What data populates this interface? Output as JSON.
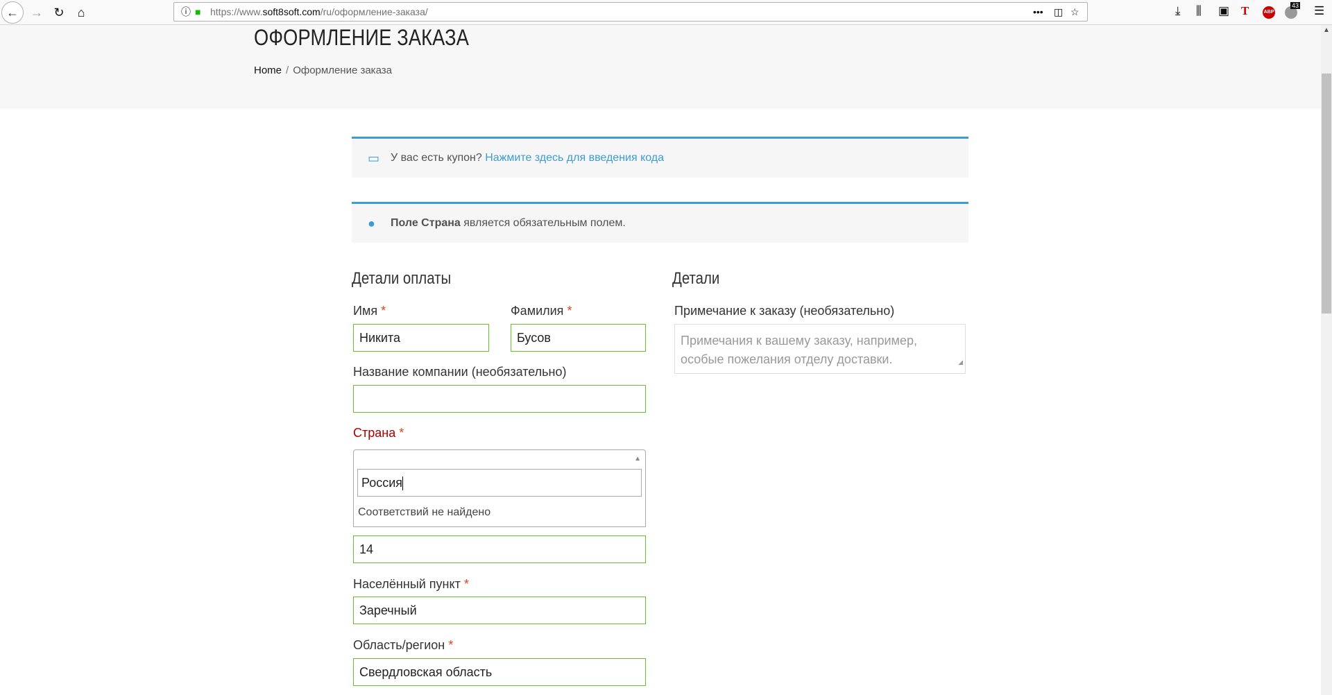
{
  "browser": {
    "url_prefix": "https://www.",
    "url_host": "soft8soft.com",
    "url_path": "/ru/оформление-заказа/",
    "badge_count": "43",
    "adblock_label": "ABP"
  },
  "page": {
    "title": "ОФОРМЛЕНИЕ ЗАКАЗА",
    "breadcrumb_home": "Home",
    "breadcrumb_sep": "/",
    "breadcrumb_current": "Оформление заказа"
  },
  "coupon_notice": {
    "text": "У вас есть купон?",
    "link": "Нажмите здесь для введения кода"
  },
  "error_notice": {
    "bold": "Поле Страна",
    "text": "является обязательным полем."
  },
  "billing": {
    "title": "Детали оплаты",
    "first_name_label": "Имя",
    "first_name_value": "Никита",
    "last_name_label": "Фамилия",
    "last_name_value": "Бусов",
    "company_label": "Название компании (необязательно)",
    "company_value": "",
    "country_label": "Страна",
    "country_search_value": "Россия",
    "country_no_results": "Соответствий не найдено",
    "address_value": "14",
    "city_label": "Населённый пункт",
    "city_value": "Заречный",
    "region_label": "Область/регион",
    "region_value": "Свердловская область",
    "required_mark": "*"
  },
  "details": {
    "title": "Детали",
    "notes_label": "Примечание к заказу (необязательно)",
    "notes_placeholder": "Примечания к вашему заказу, например, особые пожелания отделу доставки."
  },
  "colors": {
    "accent": "#3d9cd2",
    "valid_border": "#69bf29",
    "required": "#e2401c",
    "error_label": "#aa0000"
  }
}
